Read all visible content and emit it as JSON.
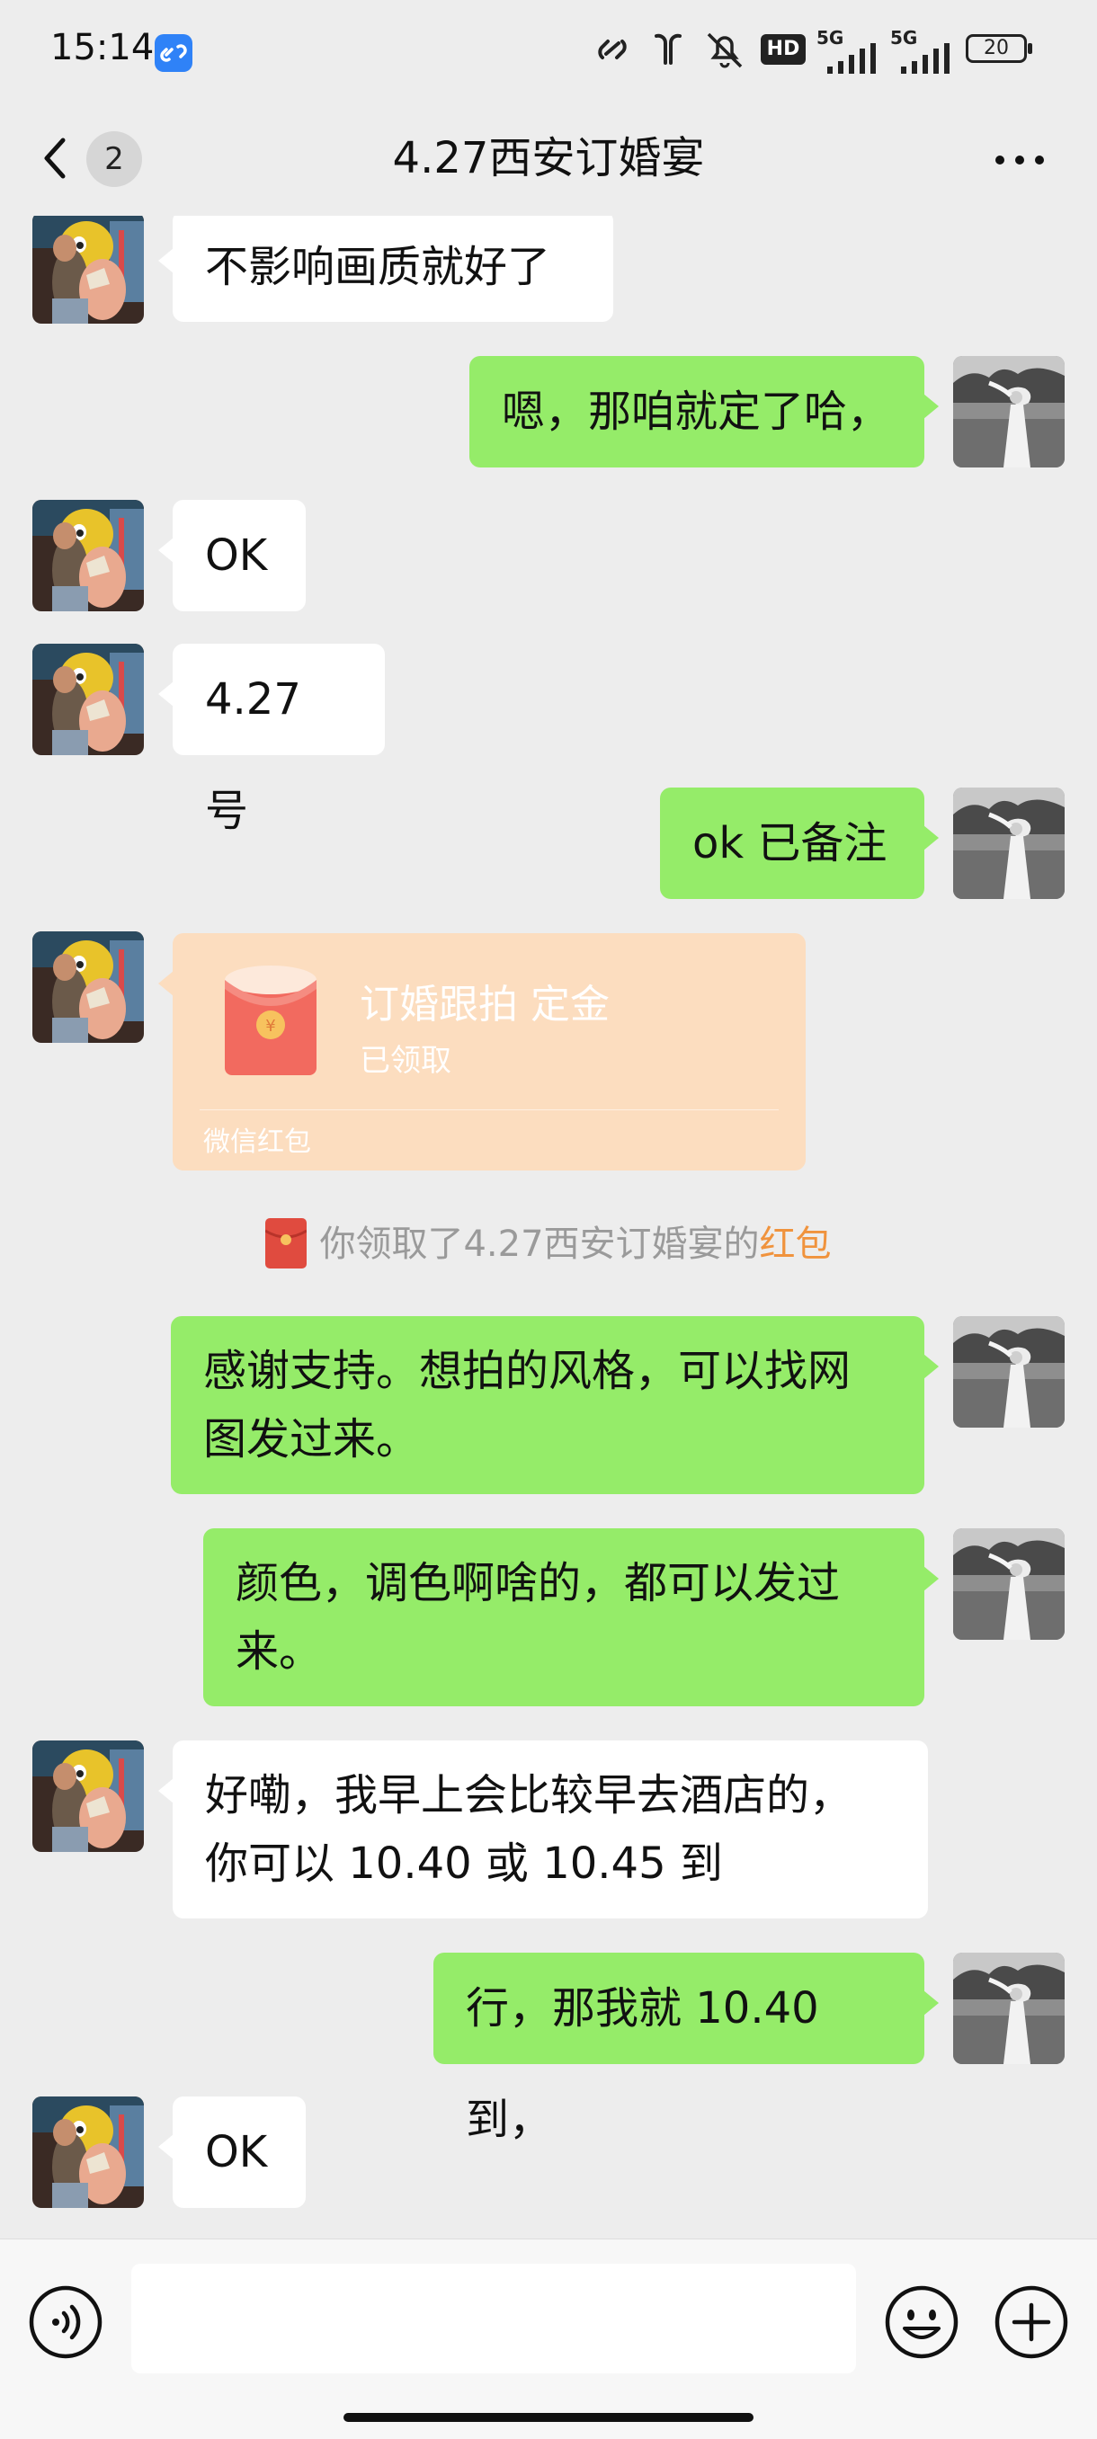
{
  "status_bar": {
    "time": "15:14",
    "hd_label": "HD",
    "network_1": "5G",
    "network_2": "5G",
    "battery": "20"
  },
  "header": {
    "title": "4.27西安订婚宴",
    "unread_count": "2"
  },
  "messages": {
    "m1": {
      "side": "left",
      "text": "不影响画质就好了"
    },
    "m2": {
      "side": "right",
      "text": "嗯，那咱就定了哈，"
    },
    "m3": {
      "side": "left",
      "text": "OK"
    },
    "m4": {
      "side": "left",
      "text": "4.27 号"
    },
    "m5": {
      "side": "right",
      "text": "ok 已备注"
    },
    "m6": {
      "side": "left",
      "type": "red-packet",
      "title": "订婚跟拍 定金",
      "status": "已领取",
      "footer": "微信红包"
    },
    "m7": {
      "side": "right",
      "text": "感谢支持。想拍的风格，可以找网\n图发过来。"
    },
    "m8": {
      "side": "right",
      "text": "颜色，调色啊啥的，都可以发过\n来。"
    },
    "m9": {
      "side": "left",
      "text": "好嘞，我早上会比较早去酒店的，\n你可以 10.40 或 10.45 到"
    },
    "m10": {
      "side": "right",
      "text": "行，那我就 10.40 到，"
    },
    "m11": {
      "side": "left",
      "text": "OK"
    }
  },
  "notice": {
    "text": "你领取了4.27西安订婚宴的",
    "link": "红包",
    "link_color": "#F0933D"
  },
  "colors": {
    "bubble_right": "#95EC69",
    "bubble_left": "#FFFFFF",
    "background": "#EDEDED",
    "red_packet": "#FCDDBF"
  },
  "icons": {
    "back": "chevron-left-icon",
    "more": "more-dots-icon",
    "voice": "voice-icon",
    "emoji": "emoji-icon",
    "plus": "plus-icon"
  }
}
